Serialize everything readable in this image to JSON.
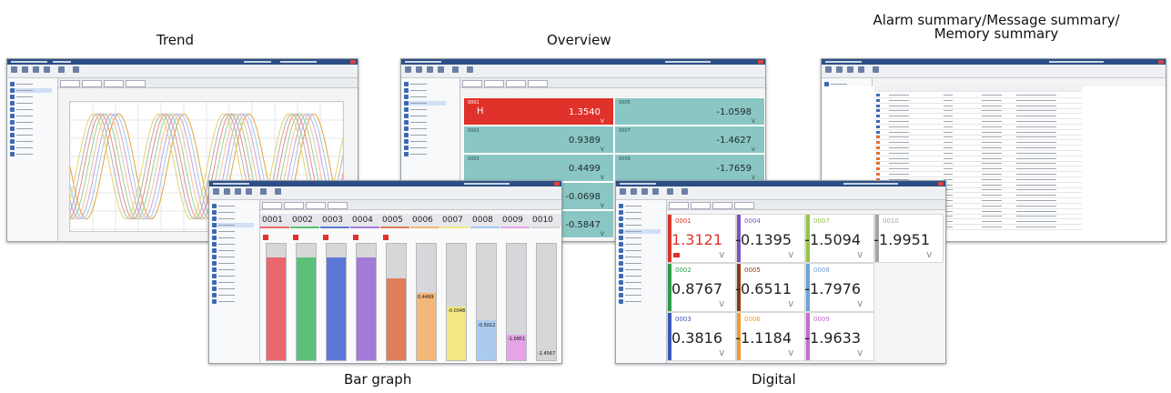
{
  "captions": {
    "trend": "Trend",
    "overview": "Overview",
    "summary_line1": "Alarm summary/Message summary/",
    "summary_line2": "Memory summary",
    "bar_graph": "Bar graph",
    "digital": "Digital"
  },
  "colors": {
    "titlebar": "#2c4e86",
    "alarm_red": "#e1312b",
    "overview_teal": "#8ac6c4"
  },
  "overview": {
    "cells": [
      {
        "channel": "0001",
        "value": "1.3540",
        "unit": "V",
        "alarm": true,
        "alarm_type": "H"
      },
      {
        "channel": "0002",
        "value": "0.9389",
        "unit": "V",
        "alarm": false
      },
      {
        "channel": "0003",
        "value": "0.4499",
        "unit": "V",
        "alarm": false
      },
      {
        "channel": "",
        "value": "-0.0698",
        "unit": "V",
        "alarm": false
      },
      {
        "channel": "",
        "value": "-0.5847",
        "unit": "V",
        "alarm": false
      },
      {
        "channel": "0005",
        "value": "-1.0598",
        "unit": "V",
        "alarm": false
      },
      {
        "channel": "0007",
        "value": "-1.4627",
        "unit": "V",
        "alarm": false
      },
      {
        "channel": "0009",
        "value": "-1.7659",
        "unit": "V",
        "alarm": false
      }
    ]
  },
  "bar_graph": {
    "channels": [
      "0001",
      "0002",
      "0003",
      "0004",
      "0005",
      "0006",
      "0007",
      "0008",
      "0009",
      "0010"
    ],
    "colors": [
      "#e9676d",
      "#5cc07a",
      "#5b78d6",
      "#a27ad8",
      "#e07d5a",
      "#f3b77a",
      "#f2e784",
      "#aacbee",
      "#e6a4e6",
      "#d4d4d6"
    ],
    "fill": [
      0.88,
      0.88,
      0.88,
      0.88,
      0.7,
      0.58,
      0.46,
      0.34,
      0.22,
      0.1
    ],
    "labels": [
      "",
      "",
      "",
      "",
      "",
      "0.4499",
      "-0.0348",
      "-0.5012",
      "-1.0951",
      "-1.4567"
    ],
    "alarm": [
      true,
      true,
      true,
      true,
      true,
      false,
      false,
      false,
      false,
      false
    ]
  },
  "digital": {
    "cells": [
      {
        "channel": "0001",
        "value": "1.3121",
        "unit": "V",
        "color": "#d9342b",
        "alarm": true
      },
      {
        "channel": "0002",
        "value": "0.8767",
        "unit": "V",
        "color": "#2f9a4a",
        "alarm": false
      },
      {
        "channel": "0003",
        "value": "0.3816",
        "unit": "V",
        "color": "#3b57b5",
        "alarm": false
      },
      {
        "channel": "0004",
        "value": "-0.1395",
        "unit": "V",
        "color": "#7d4fc1",
        "alarm": false
      },
      {
        "channel": "0005",
        "value": "-0.6511",
        "unit": "V",
        "color": "#8a3a17",
        "alarm": false
      },
      {
        "channel": "0006",
        "value": "-1.1184",
        "unit": "V",
        "color": "#f29a2e",
        "alarm": false
      },
      {
        "channel": "0007",
        "value": "-1.5094",
        "unit": "V",
        "color": "#93c548",
        "alarm": false
      },
      {
        "channel": "0008",
        "value": "-1.7976",
        "unit": "V",
        "color": "#6ea3d9",
        "alarm": false
      },
      {
        "channel": "0009",
        "value": "-1.9633",
        "unit": "V",
        "color": "#c36fcf",
        "alarm": false
      },
      {
        "channel": "0010",
        "value": "-1.9951",
        "unit": "V",
        "color": "#a4a4a4",
        "alarm": false
      }
    ]
  },
  "trend": {
    "wave_colors": [
      "#e9a23b",
      "#9ecbe8",
      "#c8a0e0",
      "#f0c39a",
      "#8fd39c",
      "#e98a8a",
      "#b0b0b0",
      "#e6d26a"
    ]
  }
}
